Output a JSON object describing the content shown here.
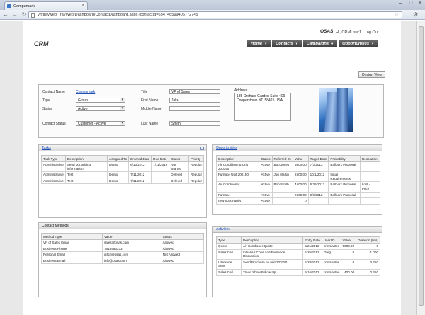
{
  "browser": {
    "tab_title": "Compumark",
    "url": "vmtravweb/TravWeb/Dashboard/ContactDashboard.aspx?contactId=634746599405772745"
  },
  "header": {
    "app_title": "CRM",
    "brand": "OSAS",
    "greeting": "Hi, CRMUser1",
    "separator": "|",
    "logout": "Log Out",
    "nav": [
      "Home",
      "Contacts",
      "Campaigns",
      "Opportunities"
    ]
  },
  "design_view_label": "Design View",
  "contact": {
    "name_label": "Contact Name",
    "name_value": "Compumark",
    "type_label": "Type",
    "type_value": "Group",
    "status_label": "Status",
    "status_value": "Active",
    "contact_status_label": "Contact Status",
    "contact_status_value": "Customer - Active",
    "title_label": "Title",
    "title_value": "VP of Sales",
    "first_name_label": "First Name",
    "first_name_value": "Jake",
    "middle_name_label": "Middle Name",
    "middle_name_value": "",
    "last_name_label": "Last Name",
    "last_name_value": "Smith",
    "address_label": "Address",
    "address_line1": "135 Orchard Garden Suite 409",
    "address_line2": "Cooperstown ND 58425 USA"
  },
  "tasks": {
    "title": "Tasks",
    "columns": [
      "Task Type",
      "Description",
      "Assigned To",
      "Entered Date",
      "Due Date",
      "Status",
      "Priority"
    ],
    "rows": [
      [
        "Administrative",
        "Send out pricing information",
        "Demo",
        "6/13/2012",
        "7/11/2012",
        "Not Started",
        "Regular"
      ],
      [
        "Administrative",
        "Test",
        "Demo",
        "7/11/2012",
        "",
        "Deleted",
        "Regular"
      ],
      [
        "Administrative",
        "Test",
        "Demo",
        "7/11/2012",
        "",
        "Deleted",
        "Regular"
      ]
    ]
  },
  "opportunities": {
    "title": "Opportunities",
    "columns": [
      "Description",
      "Status",
      "Referred By",
      "Value",
      "Target Date",
      "Probability",
      "Resolution"
    ],
    "rows": [
      [
        "Air Conditioning Unit 200350",
        "Active",
        "Bob Jones",
        "5000.00",
        "7/3/2012",
        "Ballpark Proposal",
        ""
      ],
      [
        "Furnace Unit 200150",
        "Active",
        "Jon Martin",
        "2500.00",
        "10/1/2012",
        "Initial Requirements",
        ""
      ],
      [
        "Air Conditioner",
        "Active",
        "Bob Smith",
        "4500.00",
        "6/29/2012",
        "Ballpark Proposal",
        "Lost - Price"
      ],
      [
        "Furnace",
        "Active",
        "",
        "2500.00",
        "9/3/2012",
        "Ballpark Proposal",
        ""
      ],
      [
        "new opportunity",
        "Active",
        "",
        "0",
        "",
        "",
        ""
      ]
    ]
  },
  "contact_methods": {
    "title": "Contact Methods",
    "columns": [
      "Method Type",
      "Value",
      "Status"
    ],
    "rows": [
      [
        "VP of Sales Email",
        "sales@osas.com",
        "Allowed"
      ],
      [
        "Business Phone",
        "7615553333",
        "Allowed"
      ],
      [
        "Personal Email",
        "info2@osas.com",
        "Not Allowed"
      ],
      [
        "Business Email",
        "info@osas.com",
        "Allowed"
      ]
    ]
  },
  "activities": {
    "title": "Activities",
    "columns": [
      "Type",
      "Description",
      "Entry Date",
      "User ID",
      "Value",
      "Duration (Hrs)"
    ],
    "rows": [
      [
        "Quote",
        "Air Condioner Quote",
        "5/21/2012",
        "crmmaster",
        "5000.00",
        "0"
      ],
      [
        "Sales Call",
        "Initial Air Cond and Furnance Discussion",
        "5/26/2012",
        "Greg",
        "0",
        "1.000"
      ],
      [
        "Literature Sent",
        "Send Brochure on unit 200350",
        "5/28/2012",
        "crmmaster",
        "0",
        "0.250"
      ],
      [
        "Sales Call",
        "Trade Show Follow Up",
        "9/16/2012",
        "crmmaster",
        "400.00",
        "0.250"
      ]
    ]
  }
}
